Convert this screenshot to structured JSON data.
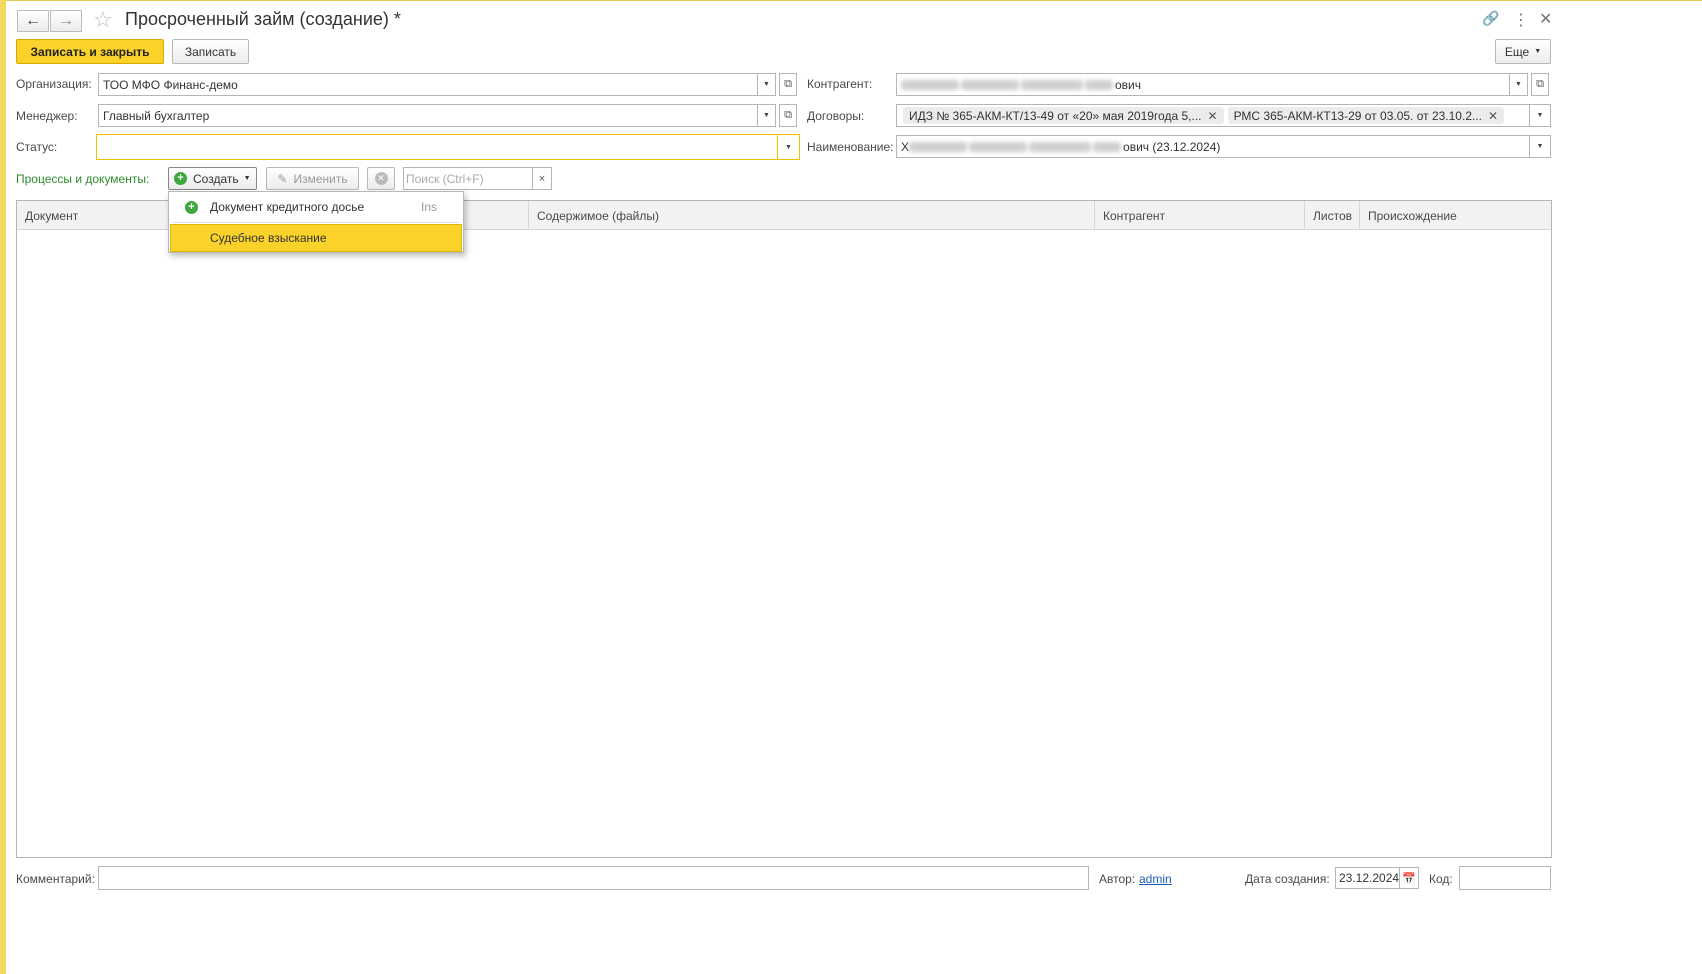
{
  "window": {
    "title": "Просроченный займ (создание) *",
    "icons": {
      "back": "arrow-left-icon",
      "forward": "arrow-right-icon",
      "favorite": "star-icon",
      "link": "link-icon",
      "menu": "vertical-dots-icon",
      "close": "close-icon"
    }
  },
  "toolbar": {
    "save_close_label": "Записать и закрыть",
    "save_label": "Записать",
    "more_label": "Еще"
  },
  "form": {
    "organization": {
      "label": "Организация:",
      "value": "ТОО МФО Финанс-демо"
    },
    "manager": {
      "label": "Менеджер:",
      "value": "Главный бухгалтер"
    },
    "status": {
      "label": "Статус:",
      "value": ""
    },
    "counterparty": {
      "label": "Контрагент:",
      "value_suffix": "ович"
    },
    "contracts": {
      "label": "Договоры:",
      "tags": [
        "ИДЗ № 365-АКМ-КТ/13-49 от «20» мая 2019года 5,...",
        "РМС 365-АКМ-КТ13-29 от 03.05. от 23.10.2..."
      ]
    },
    "name": {
      "label": "Наименование:",
      "value_prefix": "Х",
      "value_suffix": "ович (23.12.2024)"
    }
  },
  "processes": {
    "label": "Процессы и документы:",
    "create_label": "Создать",
    "edit_label": "Изменить",
    "search_placeholder": "Поиск (Ctrl+F)",
    "clear_label": "×"
  },
  "dropdown_menu": {
    "items": [
      {
        "label": "Документ кредитного досье",
        "shortcut": "Ins",
        "icon": "add-circle-icon"
      },
      {
        "label": "Судебное взыскание",
        "shortcut": ""
      }
    ]
  },
  "table": {
    "columns": [
      "Документ",
      "Содержимое (файлы)",
      "Контрагент",
      "Листов",
      "Происхождение"
    ]
  },
  "footer": {
    "comment_label": "Комментарий:",
    "comment_value": "",
    "author_label": "Автор:",
    "author_value": "admin",
    "created_label": "Дата создания:",
    "created_value": "23.12.2024",
    "code_label": "Код:",
    "code_value": ""
  },
  "colors": {
    "accent": "#fbd22a",
    "link": "#1d5fb8",
    "section_label": "#2e8b2e"
  }
}
